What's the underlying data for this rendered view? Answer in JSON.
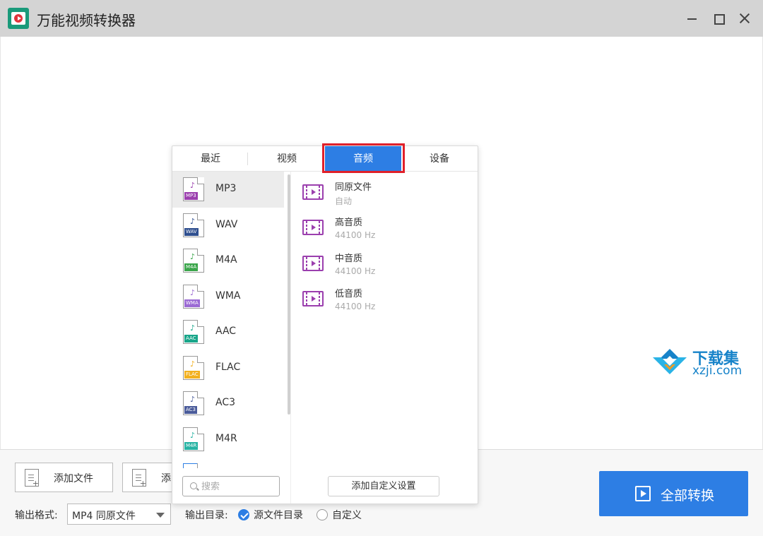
{
  "app": {
    "title": "万能视频转换器"
  },
  "tabs": [
    {
      "label": "最近"
    },
    {
      "label": "视频"
    },
    {
      "label": "音频"
    },
    {
      "label": "设备"
    }
  ],
  "active_tab": "音频",
  "formats": [
    {
      "label": "MP3",
      "tag": "MP3",
      "color": "#9b3fae",
      "selected": true
    },
    {
      "label": "WAV",
      "tag": "WAV",
      "color": "#2f4f8f"
    },
    {
      "label": "M4A",
      "tag": "M4A",
      "color": "#3aa54a"
    },
    {
      "label": "WMA",
      "tag": "WMA",
      "color": "#9b6ad4"
    },
    {
      "label": "AAC",
      "tag": "AAC",
      "color": "#19a68a"
    },
    {
      "label": "FLAC",
      "tag": "FLAC",
      "color": "#f2b01e"
    },
    {
      "label": "AC3",
      "tag": "AC3",
      "color": "#4a5b9a"
    },
    {
      "label": "M4R",
      "tag": "M4R",
      "color": "#27b3a3"
    }
  ],
  "presets": [
    {
      "name": "同原文件",
      "sub": "自动"
    },
    {
      "name": "高音质",
      "sub": "44100 Hz"
    },
    {
      "name": "中音质",
      "sub": "44100 Hz"
    },
    {
      "name": "低音质",
      "sub": "44100 Hz"
    }
  ],
  "search": {
    "placeholder": "搜索"
  },
  "add_custom_label": "添加自定义设置",
  "bottom": {
    "add_file": "添加文件",
    "add_folder": "添",
    "output_format_label": "输出格式:",
    "output_format_value": "MP4 同原文件",
    "output_dir_label": "输出目录:",
    "dir_source": "源文件目录",
    "dir_custom": "自定义",
    "convert_all": "全部转换"
  },
  "watermark": {
    "line1": "下载集",
    "line2": "xzji.com"
  },
  "colors": {
    "accent": "#2d7ee4",
    "highlight": "#e0202a",
    "preset_icon": "#9b3fae"
  }
}
